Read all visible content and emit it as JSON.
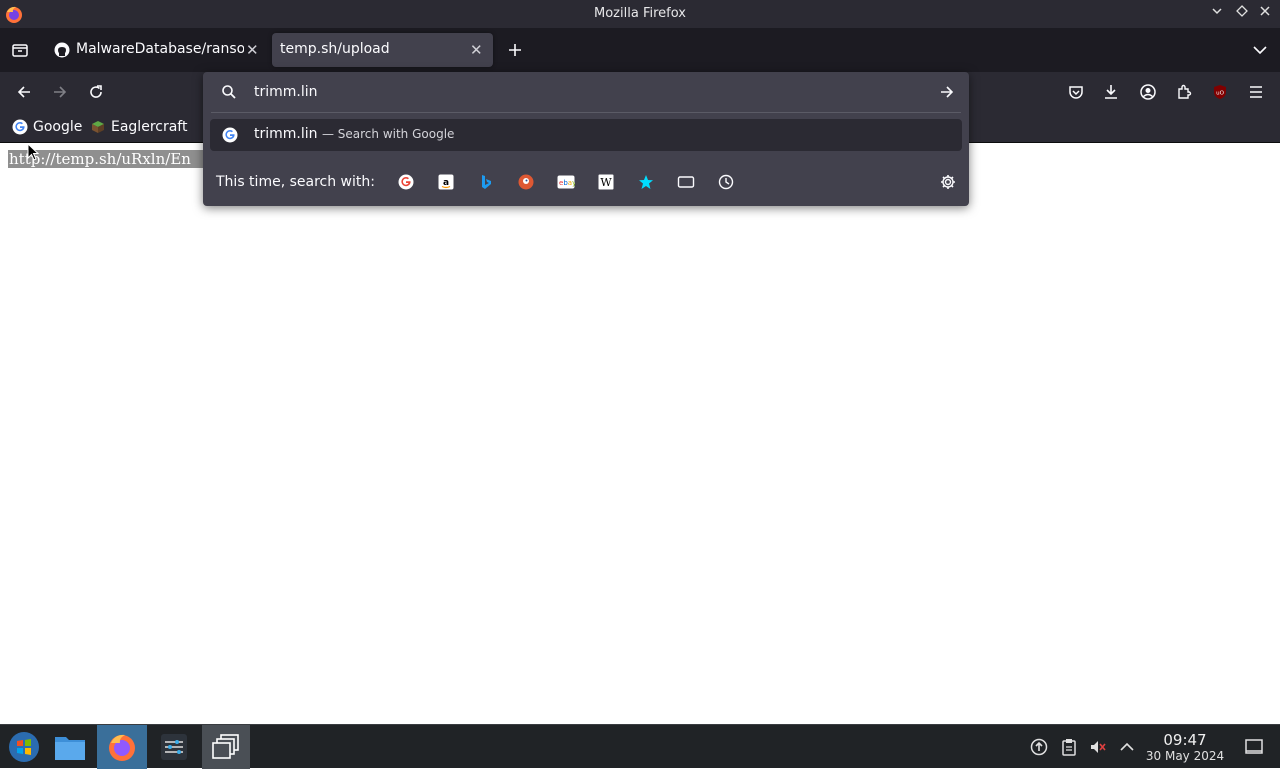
{
  "window": {
    "title": "Mozilla Firefox"
  },
  "tabs": [
    {
      "label": "MalwareDatabase/ranso",
      "icon": "github-icon",
      "active": false
    },
    {
      "label": "temp.sh/upload",
      "icon": "none",
      "active": true
    }
  ],
  "urlbar": {
    "value": "trimm.lin",
    "suggestion": {
      "title": "trimm.lin",
      "action": "— Search with Google"
    },
    "oneoff_label": "This time, search with:",
    "oneoff_engines": [
      "google-icon",
      "amazon-icon",
      "bing-icon",
      "duckduckgo-icon",
      "ebay-icon",
      "wikipedia-icon",
      "bookmarks-star-icon",
      "tabs-icon",
      "history-icon"
    ]
  },
  "bookmarks": [
    {
      "label": "Google",
      "icon": "google-icon"
    },
    {
      "label": "Eaglercraft",
      "icon": "eaglercraft-icon"
    }
  ],
  "page": {
    "text": "http://temp.sh/uRxln/En"
  },
  "taskbar": {
    "clock_time": "09:47",
    "clock_date": "30 May 2024"
  },
  "colors": {
    "toolbar_bg": "#2b2a33",
    "tabstrip_bg": "#1c1b22",
    "popup_bg": "#42414d",
    "taskbar_bg": "#202326",
    "active_taskbar": "#3a6f9a"
  }
}
